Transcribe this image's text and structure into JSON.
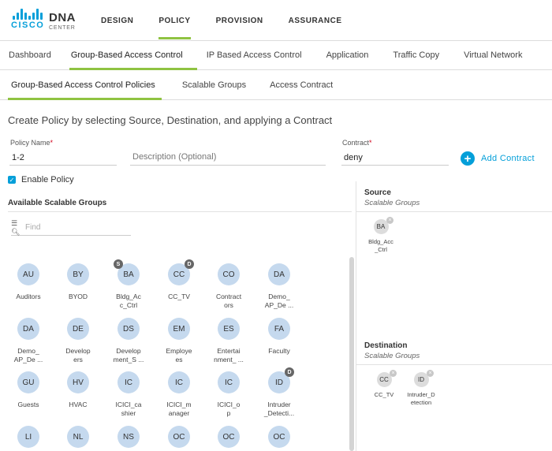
{
  "brand": {
    "cisco": "CISCO",
    "product": "DNA",
    "product_sub": "CENTER",
    "color": "#049fd9"
  },
  "main_nav": [
    {
      "label": "DESIGN",
      "active": false
    },
    {
      "label": "POLICY",
      "active": true
    },
    {
      "label": "PROVISION",
      "active": false
    },
    {
      "label": "ASSURANCE",
      "active": false
    }
  ],
  "sub_nav": [
    {
      "label": "Dashboard",
      "active": false
    },
    {
      "label": "Group-Based Access Control",
      "active": true
    },
    {
      "label": "IP Based Access Control",
      "active": false
    },
    {
      "label": "Application",
      "active": false
    },
    {
      "label": "Traffic Copy",
      "active": false
    },
    {
      "label": "Virtual Network",
      "active": false
    }
  ],
  "tabs": [
    {
      "label": "Group-Based Access Control Policies",
      "active": true
    },
    {
      "label": "Scalable Groups",
      "active": false
    },
    {
      "label": "Access Contract",
      "active": false
    }
  ],
  "form": {
    "heading": "Create Policy by selecting Source, Destination, and applying a Contract",
    "policy_name": {
      "label": "Policy Name",
      "required": "*",
      "value": "1-2"
    },
    "description": {
      "placeholder": "Description (Optional)",
      "value": ""
    },
    "contract": {
      "label": "Contract",
      "required": "*",
      "value": "deny"
    },
    "add_contract": {
      "icon": "plus-circle-icon",
      "label": "Add Contract"
    },
    "enable_policy": {
      "label": "Enable Policy",
      "checked": true
    }
  },
  "available": {
    "title": "Available Scalable Groups",
    "search": {
      "icon": "filter-search-icon",
      "placeholder": "Find"
    },
    "groups": [
      {
        "abbr": "AU",
        "name": "Auditors",
        "badge": ""
      },
      {
        "abbr": "BY",
        "name": "BYOD",
        "badge": ""
      },
      {
        "abbr": "BA",
        "name": "Bldg_Ac\nc_Ctrl",
        "badge": "S"
      },
      {
        "abbr": "CC",
        "name": "CC_TV",
        "badge": "D"
      },
      {
        "abbr": "CO",
        "name": "Contract\nors",
        "badge": ""
      },
      {
        "abbr": "DA",
        "name": "Demo_\nAP_De ...",
        "badge": ""
      },
      {
        "abbr": "DA",
        "name": "Demo_\nAP_De ...",
        "badge": ""
      },
      {
        "abbr": "DE",
        "name": "Develop\ners",
        "badge": ""
      },
      {
        "abbr": "DS",
        "name": "Develop\nment_S ...",
        "badge": ""
      },
      {
        "abbr": "EM",
        "name": "Employe\nes",
        "badge": ""
      },
      {
        "abbr": "ES",
        "name": "Entertai\nnment_ ...",
        "badge": ""
      },
      {
        "abbr": "FA",
        "name": "Faculty",
        "badge": ""
      },
      {
        "abbr": "GU",
        "name": "Guests",
        "badge": ""
      },
      {
        "abbr": "HV",
        "name": "HVAC",
        "badge": ""
      },
      {
        "abbr": "IC",
        "name": "ICICI_ca\nshier",
        "badge": ""
      },
      {
        "abbr": "IC",
        "name": "ICICI_m\nanager",
        "badge": ""
      },
      {
        "abbr": "IC",
        "name": "ICICI_o\np",
        "badge": ""
      },
      {
        "abbr": "ID",
        "name": "Intruder\n_Detecti...",
        "badge": "D"
      },
      {
        "abbr": "LI",
        "name": "",
        "badge": ""
      },
      {
        "abbr": "NL",
        "name": "",
        "badge": ""
      },
      {
        "abbr": "NS",
        "name": "",
        "badge": ""
      },
      {
        "abbr": "OC",
        "name": "",
        "badge": ""
      },
      {
        "abbr": "OC",
        "name": "",
        "badge": ""
      },
      {
        "abbr": "OC",
        "name": "",
        "badge": ""
      }
    ]
  },
  "source": {
    "title": "Source",
    "subtitle": "Scalable Groups",
    "items": [
      {
        "abbr": "BA",
        "name": "Bldg_Acc\n_Ctrl"
      }
    ]
  },
  "destination": {
    "title": "Destination",
    "subtitle": "Scalable Groups",
    "items": [
      {
        "abbr": "CC",
        "name": "CC_TV"
      },
      {
        "abbr": "ID",
        "name": "Intruder_D\netection"
      }
    ]
  },
  "colors": {
    "accent_green": "#8fc342",
    "accent_blue": "#049fd9",
    "group_circle": "#c5d9ee",
    "selected_circle": "#dcdcdc"
  }
}
